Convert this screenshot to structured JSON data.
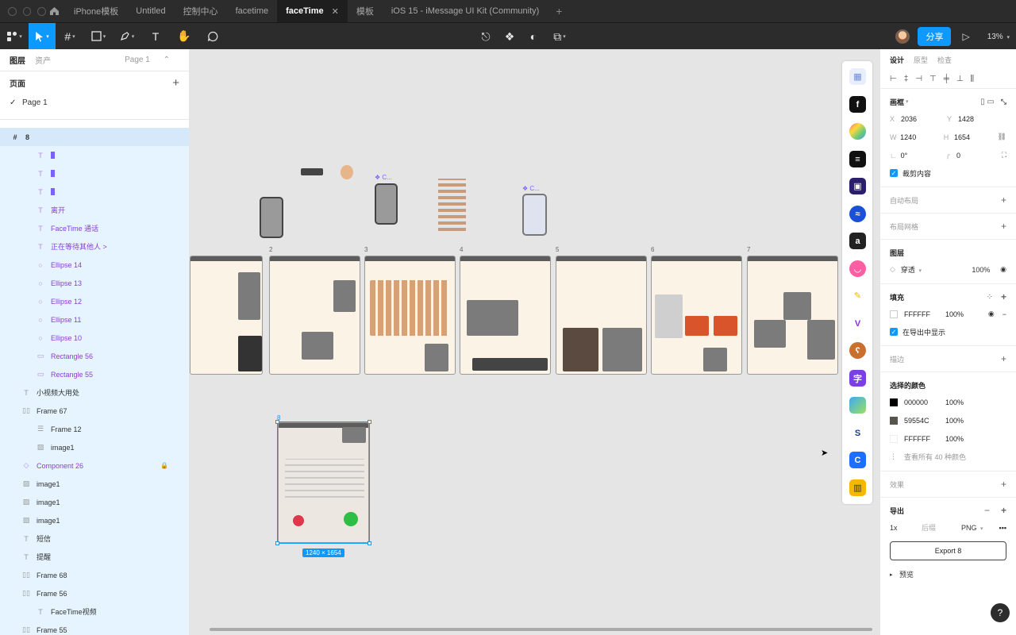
{
  "tabs": [
    {
      "label": "iPhone模板"
    },
    {
      "label": "Untitled"
    },
    {
      "label": "控制中心"
    },
    {
      "label": "facetime"
    },
    {
      "label": "faceTime"
    },
    {
      "label": "模板"
    },
    {
      "label": "iOS 15 - iMessage UI Kit (Community)"
    }
  ],
  "toolbar": {
    "share_label": "分享",
    "zoom": "13%"
  },
  "left": {
    "tab_layers": "图层",
    "tab_assets": "资产",
    "page_selector": "Page 1",
    "pages_title": "页面",
    "pages": [
      {
        "label": "Page 1"
      }
    ],
    "layers": [
      {
        "label": "8"
      },
      {
        "label": ""
      },
      {
        "label": ""
      },
      {
        "label": ""
      },
      {
        "label": "离开"
      },
      {
        "label": "FaceTime 通话"
      },
      {
        "label": "正在等待其他人 >"
      },
      {
        "label": "Ellipse 14"
      },
      {
        "label": "Ellipse 13"
      },
      {
        "label": "Ellipse 12"
      },
      {
        "label": "Ellipse 11"
      },
      {
        "label": "Ellipse 10"
      },
      {
        "label": "Rectangle 56"
      },
      {
        "label": "Rectangle 55"
      },
      {
        "label": "小视频大用处"
      },
      {
        "label": "Frame 67"
      },
      {
        "label": "Frame 12"
      },
      {
        "label": "image1"
      },
      {
        "label": "Component 26"
      },
      {
        "label": "image1"
      },
      {
        "label": "image1"
      },
      {
        "label": "image1"
      },
      {
        "label": "短信"
      },
      {
        "label": "提醒"
      },
      {
        "label": "Frame 68"
      },
      {
        "label": "Frame 56"
      },
      {
        "label": "FaceTime视频"
      },
      {
        "label": "Frame 55"
      }
    ]
  },
  "canvas": {
    "frame_numbers": [
      "2",
      "3",
      "4",
      "5",
      "6",
      "7",
      "8"
    ],
    "component_label_1": "C...",
    "component_label_2": "C...",
    "selection_size": "1240 × 1654"
  },
  "right": {
    "tab_design": "设计",
    "tab_prototype": "原型",
    "tab_inspect": "检查",
    "frame_title": "画框",
    "x_label": "X",
    "x": "2036",
    "y_label": "Y",
    "y": "1428",
    "w_label": "W",
    "w": "1240",
    "h_label": "H",
    "h": "1654",
    "rotation": "0°",
    "radius": "0",
    "clip_label": "裁剪内容",
    "auto_layout": "自动布局",
    "layout_grid": "布局网格",
    "layer_title": "图层",
    "blend": "穿透",
    "layer_opacity": "100%",
    "fill_title": "填充",
    "fill_hex": "FFFFFF",
    "fill_opacity": "100%",
    "show_in_export": "在导出中显示",
    "stroke": "描边",
    "selected_colors_title": "选择的颜色",
    "selected_colors": [
      {
        "hex": "000000",
        "opacity": "100%",
        "color": "#000000"
      },
      {
        "hex": "59554C",
        "opacity": "100%",
        "color": "#59554C"
      },
      {
        "hex": "FFFFFF",
        "opacity": "100%",
        "color": "#FFFFFF"
      }
    ],
    "view_all_colors": "查看所有 40 种颜色",
    "effects": "效果",
    "export_title": "导出",
    "export_scale": "1x",
    "export_suffix": "后缀",
    "export_format": "PNG",
    "export_button": "Export 8",
    "preview": "预览",
    "help": "?"
  }
}
